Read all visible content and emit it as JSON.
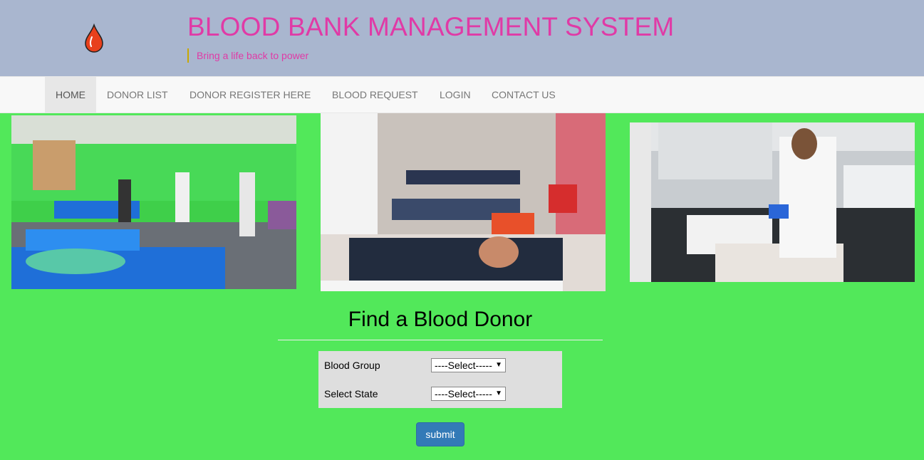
{
  "header": {
    "title": "BLOOD BANK MANAGEMENT SYSTEM",
    "tagline": "Bring a life back to power",
    "logo_icon": "blood-drop-icon"
  },
  "nav": {
    "items": [
      {
        "label": "HOME",
        "active": true
      },
      {
        "label": "DONOR LIST",
        "active": false
      },
      {
        "label": "DONOR REGISTER HERE",
        "active": false
      },
      {
        "label": "BLOOD REQUEST",
        "active": false
      },
      {
        "label": "LOGIN",
        "active": false
      },
      {
        "label": "CONTACT US",
        "active": false
      }
    ]
  },
  "find_donor": {
    "title": "Find a Blood Donor",
    "blood_group_label": "Blood Group",
    "blood_group_value": "----Select-----",
    "state_label": "Select State",
    "state_value": "----Select-----",
    "submit_label": "submit"
  },
  "colors": {
    "page_background": "#52e85a",
    "header_background": "#a9b6cf",
    "title_color": "#e03aa6",
    "button_color": "#337ab7"
  }
}
